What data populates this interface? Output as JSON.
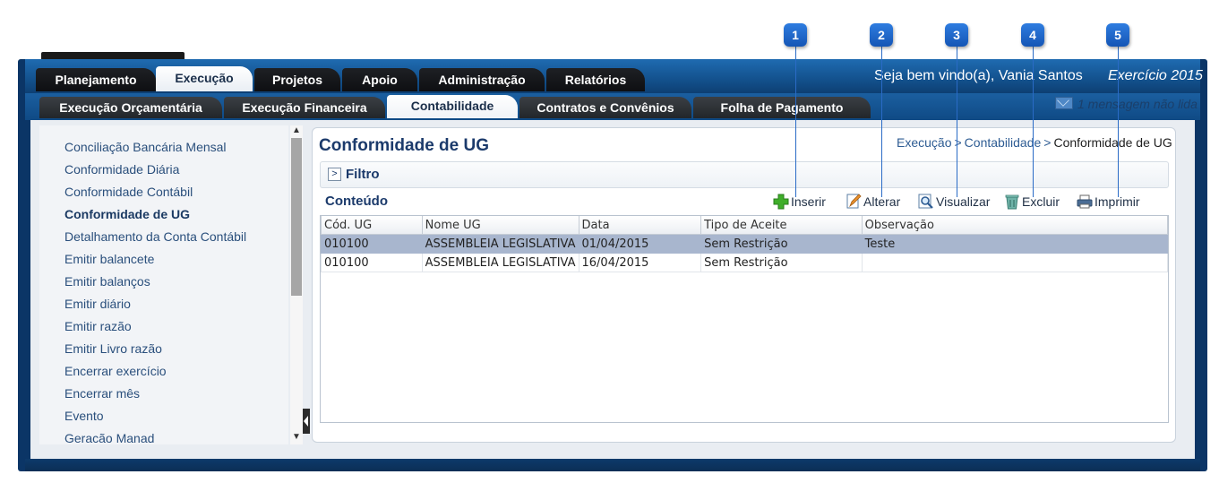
{
  "header": {
    "tabs": [
      {
        "label": "Planejamento",
        "active": false
      },
      {
        "label": "Execução",
        "active": true
      },
      {
        "label": "Projetos",
        "active": false
      },
      {
        "label": "Apoio",
        "active": false
      },
      {
        "label": "Administração",
        "active": false
      },
      {
        "label": "Relatórios",
        "active": false
      }
    ],
    "welcome": "Seja bem vindo(a), Vania Santos",
    "exercise": "Exercício 2015"
  },
  "subnav": {
    "tabs": [
      {
        "label": "Execução Orçamentária",
        "active": false
      },
      {
        "label": "Execução Financeira",
        "active": false
      },
      {
        "label": "Contabilidade",
        "active": true
      },
      {
        "label": "Contratos e Convênios",
        "active": false
      },
      {
        "label": "Folha de Pagamento",
        "active": false
      }
    ],
    "messages": "1 mensagem não lida"
  },
  "sidebar": {
    "items": [
      {
        "label": "Conciliação Bancária Mensal",
        "active": false
      },
      {
        "label": "Conformidade Diária",
        "active": false
      },
      {
        "label": "Conformidade Contábil",
        "active": false
      },
      {
        "label": "Conformidade de UG",
        "active": true
      },
      {
        "label": "Detalhamento da Conta Contábil",
        "active": false
      },
      {
        "label": "Emitir balancete",
        "active": false
      },
      {
        "label": "Emitir balanços",
        "active": false
      },
      {
        "label": "Emitir diário",
        "active": false
      },
      {
        "label": "Emitir razão",
        "active": false
      },
      {
        "label": "Emitir Livro razão",
        "active": false
      },
      {
        "label": "Encerrar exercício",
        "active": false
      },
      {
        "label": "Encerrar mês",
        "active": false
      },
      {
        "label": "Evento",
        "active": false
      },
      {
        "label": "Geracão Manad",
        "active": false
      }
    ]
  },
  "panel": {
    "title": "Conformidade de UG",
    "breadcrumb": {
      "part1": "Execução",
      "part2": "Contabilidade",
      "current": "Conformidade de UG",
      "sep": ">"
    },
    "filter_label": "Filtro",
    "filter_toggle": ">",
    "content_label": "Conteúdo"
  },
  "toolbar": {
    "insert": "Inserir",
    "edit": "Alterar",
    "view": "Visualizar",
    "delete": "Excluir",
    "print": "Imprimir"
  },
  "table": {
    "columns": [
      "Cód. UG",
      "Nome UG",
      "Data",
      "Tipo de Aceite",
      "Observação"
    ],
    "rows": [
      {
        "cells": [
          "010100",
          "ASSEMBLEIA LEGISLATIVA",
          "01/04/2015",
          "Sem Restrição",
          "Teste"
        ],
        "selected": true
      },
      {
        "cells": [
          "010100",
          "ASSEMBLEIA LEGISLATIVA",
          "16/04/2015",
          "Sem Restrição",
          ""
        ],
        "selected": false
      }
    ]
  },
  "callouts": [
    "1",
    "2",
    "3",
    "4",
    "5"
  ],
  "colors": {
    "brand_blue": "#13518d",
    "dark_tab": "#1e2024",
    "title_blue": "#1b3a6b",
    "selected_row": "#a8b6ce",
    "callout_blue": "#1f6acb"
  }
}
